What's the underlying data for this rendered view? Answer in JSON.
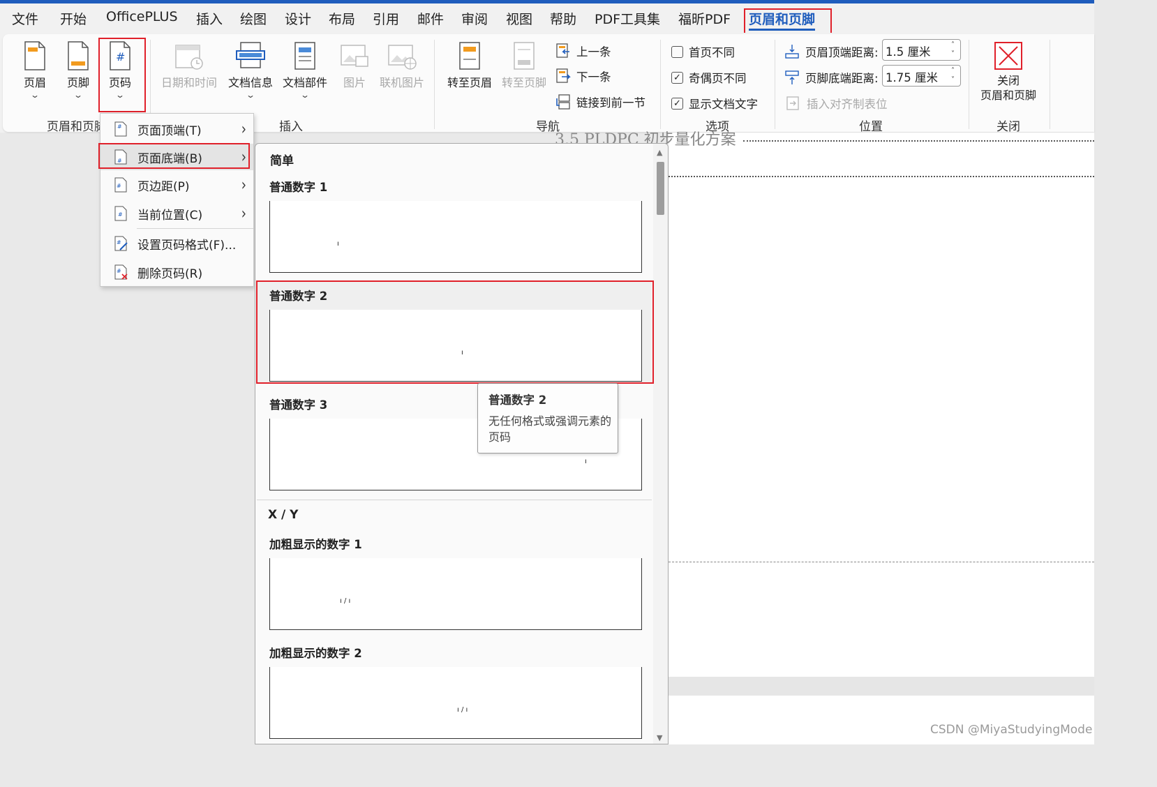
{
  "menu_tabs": [
    "文件",
    "开始",
    "OfficePLUS",
    "插入",
    "绘图",
    "设计",
    "布局",
    "引用",
    "邮件",
    "审阅",
    "视图",
    "帮助",
    "PDF工具集",
    "福昕PDF",
    "页眉和页脚"
  ],
  "ribbon": {
    "hf_group": {
      "header": "页眉",
      "footer": "页脚",
      "page_number": "页码",
      "label": "页眉和页脚"
    },
    "insert_group": {
      "date_time": "日期和时间",
      "doc_info": "文档信息",
      "doc_parts": "文档部件",
      "picture": "图片",
      "online_picture": "联机图片",
      "label": "插入"
    },
    "nav_group": {
      "goto_header": "转至页眉",
      "goto_footer": "转至页脚",
      "previous": "上一条",
      "next": "下一条",
      "link_previous": "链接到前一节",
      "label": "导航"
    },
    "options_group": {
      "different_first": "首页不同",
      "different_odd_even": "奇偶页不同",
      "show_doc_text": "显示文档文字",
      "label": "选项",
      "checked": [
        false,
        true,
        true
      ]
    },
    "position_group": {
      "header_top_label": "页眉顶端距离:",
      "header_top_value": "1.5 厘米",
      "footer_bottom_label": "页脚底端距离:",
      "footer_bottom_value": "1.75 厘米",
      "insert_align_tab": "插入对齐制表位",
      "label": "位置"
    },
    "close_group": {
      "close_line1": "关闭",
      "close_line2": "页眉和页脚",
      "label": "关闭"
    }
  },
  "context_menu": {
    "items": [
      {
        "label": "页面顶端(T)",
        "submenu": true
      },
      {
        "label": "页面底端(B)",
        "submenu": true
      },
      {
        "label": "页边距(P)",
        "submenu": true
      },
      {
        "label": "当前位置(C)",
        "submenu": true
      },
      {
        "label": "设置页码格式(F)...",
        "submenu": false
      },
      {
        "label": "删除页码(R)",
        "submenu": false
      }
    ]
  },
  "gallery": {
    "categories": [
      {
        "name": "简单",
        "items": [
          {
            "title": "普通数字 1",
            "mark": "ı"
          },
          {
            "title": "普通数字 2",
            "mark": "ı"
          },
          {
            "title": "普通数字 3",
            "mark": "ı"
          }
        ]
      },
      {
        "name": "X / Y",
        "items": [
          {
            "title": "加粗显示的数字 1",
            "mark": "ı / ı"
          },
          {
            "title": "加粗显示的数字 2",
            "mark": "ı / ı"
          }
        ]
      }
    ]
  },
  "tooltip": {
    "title": "普通数字 2",
    "description": "无任何格式或强调元素的页码"
  },
  "document": {
    "heading": "3.5 PLDPC 初步量化方案"
  },
  "watermark": "CSDN @MiyaStudyingMode",
  "colors": {
    "accent": "#1f5dbd",
    "highlight_box": "#e0202a",
    "ribbon_bg": "#fbfbfb"
  }
}
